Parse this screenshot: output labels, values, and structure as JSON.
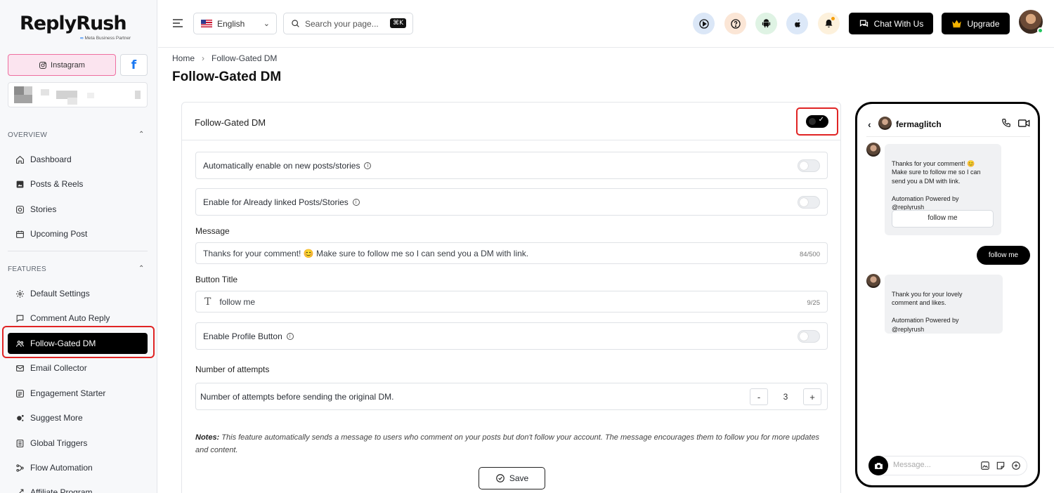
{
  "brand": {
    "name": "ReplyRush",
    "partner_badge": "Meta Business Partner"
  },
  "platforms": {
    "instagram_label": "Instagram",
    "facebook_label": "f"
  },
  "sidebar": {
    "overview_title": "OVERVIEW",
    "features_title": "FEATURES",
    "overview_items": [
      {
        "label": "Dashboard",
        "icon": "home-icon"
      },
      {
        "label": "Posts & Reels",
        "icon": "image-icon"
      },
      {
        "label": "Stories",
        "icon": "stories-icon"
      },
      {
        "label": "Upcoming Post",
        "icon": "calendar-icon"
      }
    ],
    "feature_items": [
      {
        "label": "Default Settings",
        "icon": "gear-icon"
      },
      {
        "label": "Comment Auto Reply",
        "icon": "comment-icon"
      },
      {
        "label": "Follow-Gated DM",
        "icon": "users-icon",
        "active": true
      },
      {
        "label": "Email Collector",
        "icon": "mail-icon"
      },
      {
        "label": "Engagement Starter",
        "icon": "engagement-icon"
      },
      {
        "label": "Suggest More",
        "icon": "suggest-icon"
      },
      {
        "label": "Global Triggers",
        "icon": "triggers-icon"
      },
      {
        "label": "Flow Automation",
        "icon": "flow-icon"
      },
      {
        "label": "Affiliate Program",
        "icon": "affiliate-icon"
      }
    ]
  },
  "topbar": {
    "language": "English",
    "search_placeholder": "Search your page...",
    "search_shortcut": "⌘K",
    "chat_label": "Chat With Us",
    "upgrade_label": "Upgrade"
  },
  "breadcrumb": {
    "home": "Home",
    "current": "Follow-Gated DM"
  },
  "page_title": "Follow-Gated DM",
  "form": {
    "card_title": "Follow-Gated DM",
    "main_enabled": true,
    "auto_enable_label": "Automatically enable on new posts/stories",
    "auto_enable_on": false,
    "linked_label": "Enable for Already linked Posts/Stories",
    "linked_on": false,
    "message_label": "Message",
    "message_value": "Thanks for your comment! 😊 Make sure to follow me so I can send you a DM with link.",
    "message_count": "84/500",
    "button_title_label": "Button Title",
    "button_title_value": "follow me",
    "button_title_count": "9/25",
    "profile_button_label": "Enable Profile Button",
    "profile_button_on": false,
    "attempts_label": "Number of attempts",
    "attempts_desc": "Number of attempts before sending the original DM.",
    "attempts_value": "3",
    "notes_prefix": "Notes:",
    "notes_text": " This feature automatically sends a message to users who comment on your posts but don't follow your account. The message encourages them to follow you for more updates and content.",
    "save_label": "Save"
  },
  "preview": {
    "username": "fermaglitch",
    "msg1": "Thanks for your comment! 😊\nMake sure to follow me so I can\nsend you a DM with link.\n\nAutomation Powered by\n@replyrush",
    "msg1_button": "follow me",
    "reply": "follow me",
    "msg2": "Thank you for your lovely\ncomment and likes.\n\nAutomation Powered by\n@replyrush",
    "input_placeholder": "Message..."
  }
}
